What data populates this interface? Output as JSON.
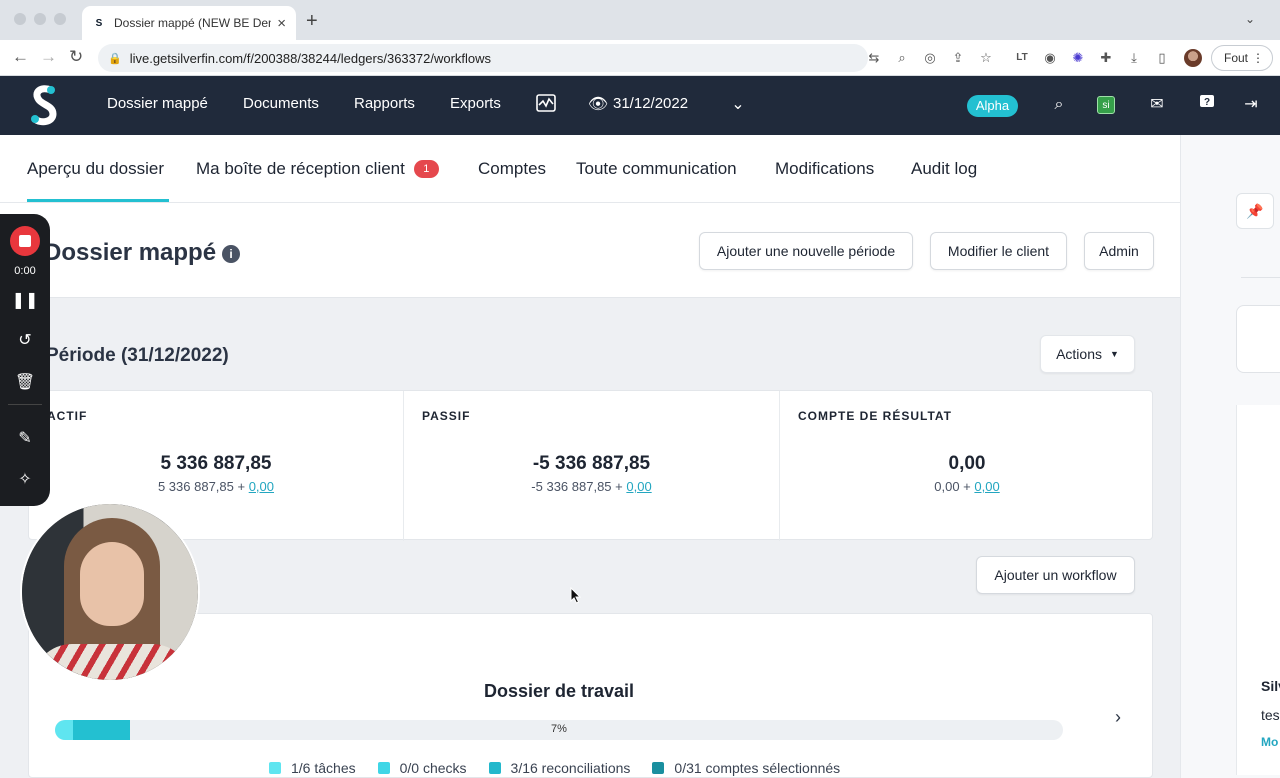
{
  "browser": {
    "tab_title": "Dossier mappé (NEW BE Demo",
    "tab_favicon": "S",
    "url": "live.getsilverfin.com/f/200388/38244/ledgers/363372/workflows",
    "profile_button": "Fout"
  },
  "header": {
    "nav": [
      "Dossier mappé",
      "Documents",
      "Rapports",
      "Exports"
    ],
    "period": "31/12/2022",
    "alpha_badge": "Alpha",
    "si_label": "si"
  },
  "subnav": {
    "items": [
      "Aperçu du dossier",
      "Ma boîte de réception client",
      "Comptes",
      "Toute communication",
      "Modifications",
      "Audit log"
    ],
    "inbox_badge": "1"
  },
  "page": {
    "title": "Dossier mappé",
    "buttons": {
      "new_period": "Ajouter une nouvelle période",
      "edit_client": "Modifier le client",
      "admin": "Admin"
    }
  },
  "period": {
    "title": "Période (31/12/2022)",
    "actions_label": "Actions"
  },
  "summary": [
    {
      "heading": "ACTIF",
      "value": "5 336 887,85",
      "base": "5 336 887,85 +",
      "extra": "0,00"
    },
    {
      "heading": "PASSIF",
      "value": "-5 336 887,85",
      "base": "-5 336 887,85 +",
      "extra": "0,00"
    },
    {
      "heading": "COMPTE DE RÉSULTAT",
      "value": "0,00",
      "base": "0,00 +",
      "extra": "0,00"
    }
  ],
  "workflow": {
    "add_button": "Ajouter un workflow",
    "title": "Dossier de travail",
    "progress_label": "7%",
    "progress_fraction": 0.074,
    "progress_light_fraction": 0.018,
    "legend": [
      {
        "label": "1/6 tâches",
        "color": "#5fe5f0"
      },
      {
        "label": "0/0 checks",
        "color": "#3fd6e6"
      },
      {
        "label": "3/16 reconciliations",
        "color": "#23b8cc"
      },
      {
        "label": "0/31 comptes sélectionnés",
        "color": "#1a8f9f"
      }
    ]
  },
  "right_panel": {
    "text1": "Silv",
    "text2": "tes",
    "link": "Mo"
  },
  "recorder": {
    "time": "0:00"
  },
  "colors": {
    "header_bg": "#202a3b",
    "accent": "#23c0d1",
    "badge_red": "#e5484d"
  }
}
